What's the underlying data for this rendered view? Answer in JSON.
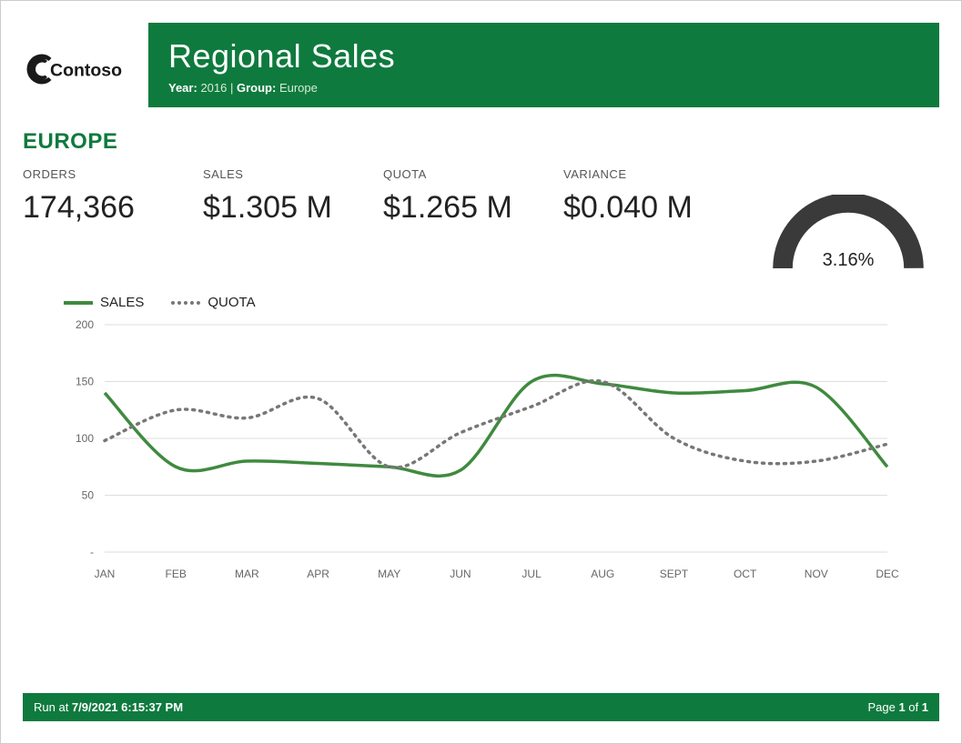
{
  "logo_text": "Contoso",
  "header": {
    "title": "Regional Sales",
    "year_label": "Year:",
    "year_value": "2016",
    "group_label": "Group:",
    "group_value": "Europe"
  },
  "region_heading": "EUROPE",
  "metrics": {
    "orders_label": "ORDERS",
    "orders_value": "174,366",
    "sales_label": "SALES",
    "sales_value": "$1.305 M",
    "quota_label": "QUOTA",
    "quota_value": "$1.265 M",
    "variance_label": "VARIANCE",
    "variance_value": "$0.040 M",
    "gauge_value": "3.16%"
  },
  "legend": {
    "sales": "SALES",
    "quota": "QUOTA"
  },
  "footer": {
    "run_label": "Run at ",
    "run_time": "7/9/2021 6:15:37 PM",
    "page_label": "Page ",
    "page_num": "1",
    "page_of": " of ",
    "page_total": "1"
  },
  "colors": {
    "brand_green": "#0f7a3e",
    "line_green": "#3f8a3f",
    "gauge_gray": "#3a3a3a"
  },
  "chart_data": {
    "type": "line",
    "title": "",
    "xlabel": "",
    "ylabel": "",
    "ylim": [
      0,
      200
    ],
    "y_ticks": [
      0,
      50,
      100,
      150,
      200
    ],
    "y_tick_labels": [
      "-",
      "50",
      "100",
      "150",
      "200"
    ],
    "categories": [
      "JAN",
      "FEB",
      "MAR",
      "APR",
      "MAY",
      "JUN",
      "JUL",
      "AUG",
      "SEPT",
      "OCT",
      "NOV",
      "DEC"
    ],
    "series": [
      {
        "name": "SALES",
        "style": "solid",
        "color": "#3f8a3f",
        "values": [
          140,
          75,
          80,
          78,
          75,
          72,
          150,
          148,
          140,
          142,
          145,
          75
        ]
      },
      {
        "name": "QUOTA",
        "style": "dotted",
        "color": "#777777",
        "values": [
          98,
          125,
          118,
          135,
          75,
          105,
          128,
          150,
          100,
          80,
          80,
          95
        ]
      }
    ],
    "legend_position": "top"
  }
}
